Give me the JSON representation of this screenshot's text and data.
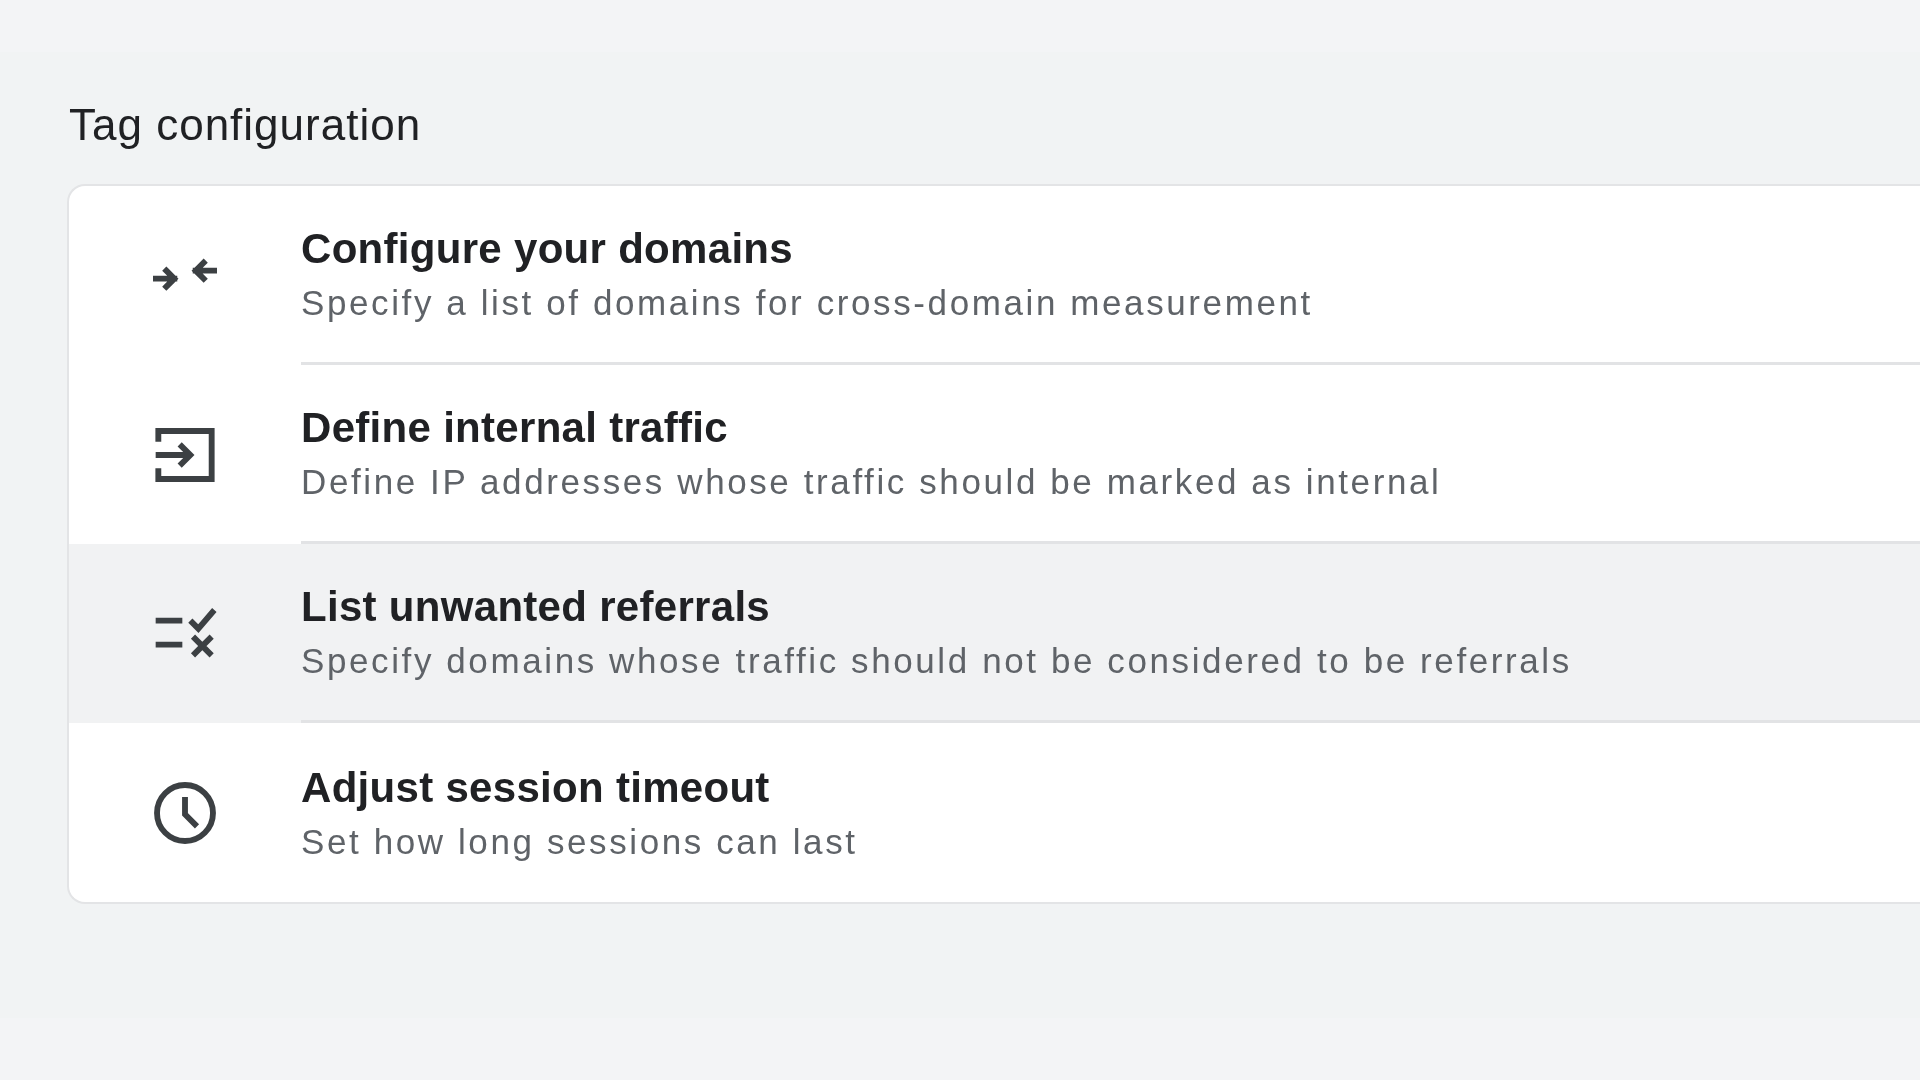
{
  "section_title": "Tag configuration",
  "items": [
    {
      "kind": "merge",
      "title": "Configure your domains",
      "description": "Specify a list of domains for cross-domain measurement",
      "selected": false
    },
    {
      "kind": "enter",
      "title": "Define internal traffic",
      "description": "Define IP addresses whose traffic should be marked as internal",
      "selected": false
    },
    {
      "kind": "checklist",
      "title": "List unwanted referrals",
      "description": "Specify domains whose traffic should not be considered to be referrals",
      "selected": true
    },
    {
      "kind": "clock",
      "title": "Adjust session timeout",
      "description": "Set how long sessions can last",
      "selected": false
    }
  ]
}
